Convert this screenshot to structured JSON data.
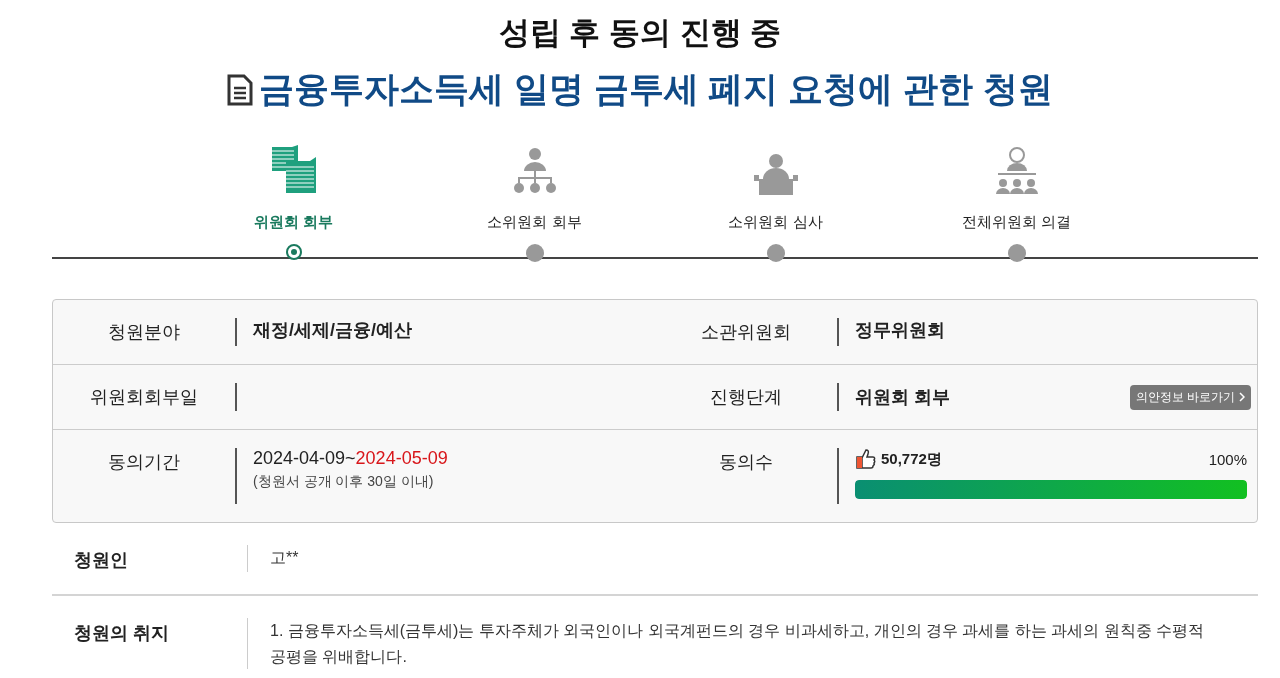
{
  "status": "성립 후 동의 진행 중",
  "title": "금융투자소득세 일명 금투세 폐지 요청에 관한 청원",
  "steps": [
    {
      "kind": "documents",
      "label": "위원회 회부",
      "selected": true
    },
    {
      "kind": "org",
      "label": "소위원회 회부",
      "selected": false
    },
    {
      "kind": "podium",
      "label": "소위원회 심사",
      "selected": false
    },
    {
      "kind": "assembly",
      "label": "전체위원회 의결",
      "selected": false
    }
  ],
  "info": {
    "field_label": "청원분야",
    "field_value": "재정/세제/금융/예산",
    "committee_label": "소관위원회",
    "committee_value": "정무위원회",
    "referral_label": "위원회회부일",
    "stage_label": "진행단계",
    "stage_value": "위원회 회부",
    "bill_link": "의안정보 바로가기",
    "period_label": "동의기간",
    "period_start": "2024-04-09~",
    "period_end": "2024-05-09",
    "period_note": "(청원서 공개 이후 30일 이내)",
    "agree_label": "동의수",
    "agree_count": "50,772명",
    "agree_percent": "100%",
    "level": 1.0
  },
  "petitioner": {
    "label": "청원인",
    "value": "고**"
  },
  "purpose": {
    "label": "청원의 취지",
    "text": "1. 금융투자소득세(금투세)는 투자주체가 외국인이나 외국계펀드의 경우 비과세하고, 개인의 경우 과세를 하는 과세의 원칙중 수평적 공평을 위배합니다."
  }
}
